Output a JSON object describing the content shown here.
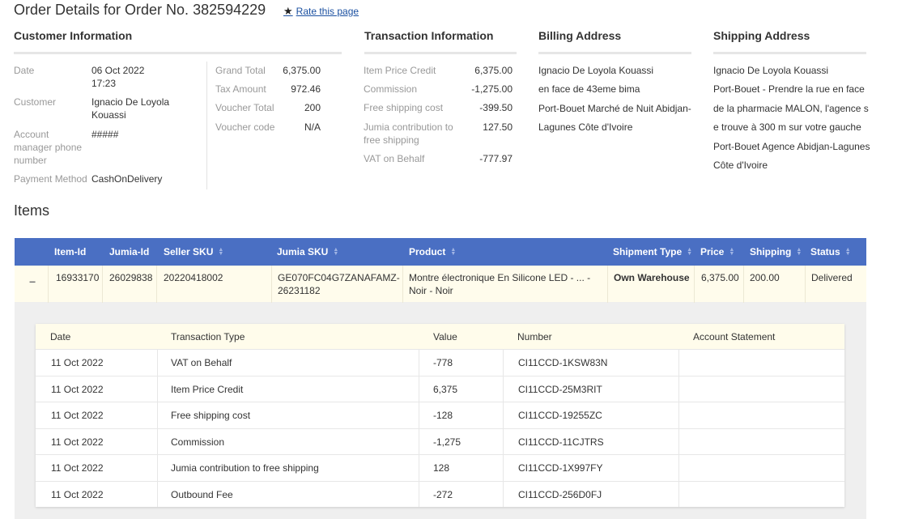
{
  "header": {
    "title": "Order Details for Order No. 382594229",
    "rate_label": "Rate this page"
  },
  "sections": {
    "customer": "Customer Information",
    "transaction": "Transaction Information",
    "billing": "Billing Address",
    "shipping": "Shipping Address"
  },
  "customer": {
    "date_label": "Date",
    "date_value": "06 Oct 2022",
    "time_value": "17:23",
    "customer_label": "Customer",
    "customer_line1": "Ignacio De Loyola",
    "customer_line2": "Kouassi",
    "acct_label_1": "Account",
    "acct_label_2": "manager phone",
    "acct_label_3": "number",
    "acct_value": "#####",
    "payment_label": "Payment Method",
    "payment_value": "CashOnDelivery"
  },
  "totals": {
    "grand_total_label": "Grand Total",
    "grand_total_value": "6,375.00",
    "tax_label": "Tax Amount",
    "tax_value": "972.46",
    "voucher_total_label": "Voucher Total",
    "voucher_total_value": "200",
    "voucher_code_label": "Voucher code",
    "voucher_code_value": "N/A"
  },
  "transaction": {
    "item_price_label": "Item Price Credit",
    "item_price_value": "6,375.00",
    "commission_label": "Commission",
    "commission_value": "-1,275.00",
    "free_ship_label": "Free shipping cost",
    "free_ship_value": "-399.50",
    "jumia_contrib_label_1": "Jumia contribution to",
    "jumia_contrib_label_2": "free shipping",
    "jumia_contrib_value": "127.50",
    "vat_label": "VAT on Behalf",
    "vat_value": "-777.97"
  },
  "billing": {
    "line1": "Ignacio De Loyola Kouassi",
    "line2": "en face de 43eme bima",
    "line3": "Port-Bouet Marché de Nuit Abidjan-",
    "line4": "Lagunes Côte d'Ivoire"
  },
  "shipping": {
    "line1": "Ignacio De Loyola Kouassi",
    "line2": "Port-Bouet - Prendre la rue en face",
    "line3": "de la pharmacie MALON, l'agence s",
    "line4": "e trouve à 300 m sur votre gauche",
    "line5": "Port-Bouet Agence Abidjan-Lagunes",
    "line6": "Côte d'Ivoire"
  },
  "items": {
    "title": "Items",
    "headers": {
      "item_id": "Item-Id",
      "jumia_id": "Jumia-Id",
      "seller_sku": "Seller SKU",
      "jumia_sku": "Jumia SKU",
      "product": "Product",
      "shipment_type": "Shipment Type",
      "price": "Price",
      "shipping": "Shipping",
      "status": "Status"
    },
    "row": {
      "toggle": "−",
      "item_id": "16933170",
      "jumia_id": "26029838",
      "seller_sku": "20220418002",
      "jumia_sku_1": "GE070FC04G7ZANAFAMZ-",
      "jumia_sku_2": "26231182",
      "product_1": "Montre électronique En Silicone LED - ... -",
      "product_2": "Noir - Noir",
      "shipment_type": "Own Warehouse",
      "price": "6,375.00",
      "shipping": "200.00",
      "status": "Delivered"
    }
  },
  "transactions_table": {
    "headers": {
      "date": "Date",
      "type": "Transaction Type",
      "value": "Value",
      "number": "Number",
      "statement": "Account Statement"
    },
    "rows": [
      {
        "date": "11 Oct 2022",
        "type": "VAT on Behalf",
        "value": "-778",
        "number": "CI11CCD-1KSW83N"
      },
      {
        "date": "11 Oct 2022",
        "type": "Item Price Credit",
        "value": "6,375",
        "number": "CI11CCD-25M3RIT"
      },
      {
        "date": "11 Oct 2022",
        "type": "Free shipping cost",
        "value": "-128",
        "number": "CI11CCD-19255ZC"
      },
      {
        "date": "11 Oct 2022",
        "type": "Commission",
        "value": "-1,275",
        "number": "CI11CCD-11CJTRS"
      },
      {
        "date": "11 Oct 2022",
        "type": "Jumia contribution to free shipping",
        "value": "128",
        "number": "CI11CCD-1X997FY"
      },
      {
        "date": "11 Oct 2022",
        "type": "Outbound Fee",
        "value": "-272",
        "number": "CI11CCD-256D0FJ"
      }
    ]
  }
}
